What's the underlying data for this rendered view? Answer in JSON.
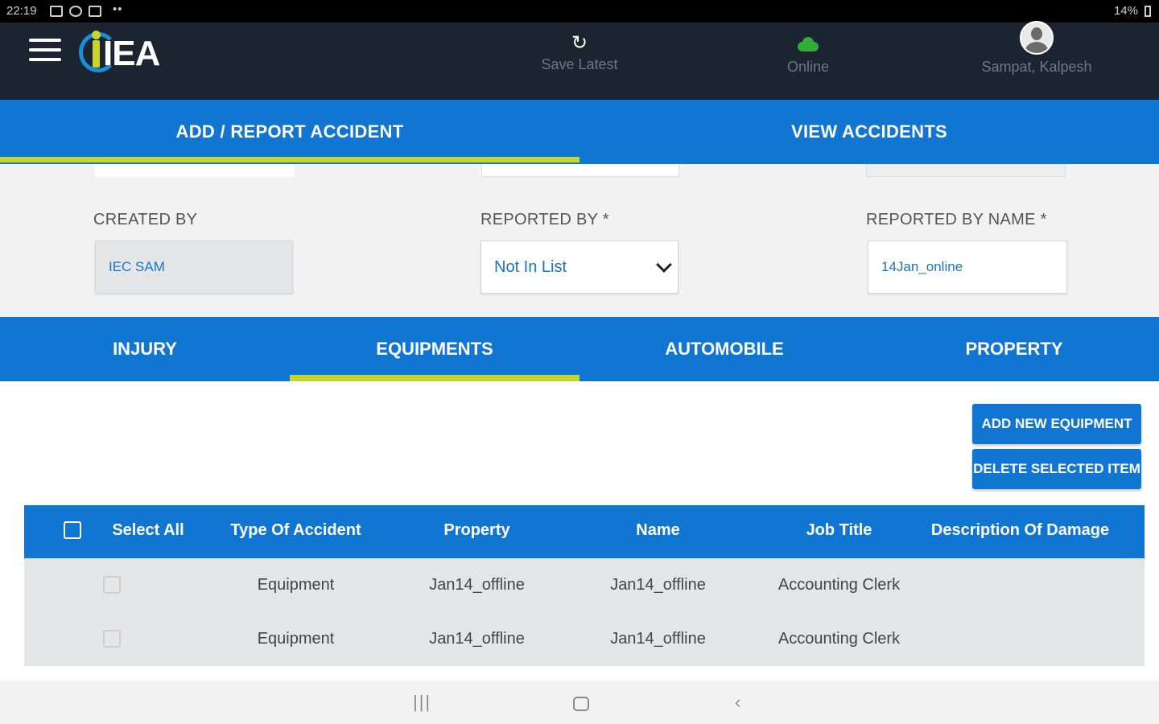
{
  "status_bar": {
    "time": "22:19",
    "dots": "••",
    "battery": "14%"
  },
  "header": {
    "logo_text": "IEA",
    "actions": [
      {
        "label": "Save Latest",
        "icon": "sync-icon"
      },
      {
        "label": "Online",
        "icon": "cloud-icon",
        "color": "#2fae3a"
      },
      {
        "label": "Sampat, Kalpesh",
        "icon": "avatar-icon"
      }
    ]
  },
  "top_tabs": [
    {
      "label": "ADD / REPORT ACCIDENT",
      "active": true
    },
    {
      "label": "VIEW ACCIDENTS",
      "active": false
    }
  ],
  "form": {
    "created_by": {
      "label": "CREATED BY",
      "value": "IEC SAM"
    },
    "reported_by": {
      "label": "REPORTED BY *",
      "value": "Not In List"
    },
    "reported_by_name": {
      "label": "REPORTED BY NAME *",
      "value": "14Jan_online"
    }
  },
  "sub_tabs": [
    {
      "label": "INJURY",
      "active": false
    },
    {
      "label": "EQUIPMENTS",
      "active": true
    },
    {
      "label": "AUTOMOBILE",
      "active": false
    },
    {
      "label": "PROPERTY",
      "active": false
    }
  ],
  "buttons": {
    "add_new": "ADD NEW EQUIPMENT",
    "delete_selected": "DELETE SELECTED ITEM"
  },
  "table": {
    "columns": [
      "Select All",
      "Type Of Accident",
      "Property",
      "Name",
      "Job Title",
      "Description Of Damage"
    ],
    "rows": [
      {
        "type": "Equipment",
        "property": "Jan14_offline",
        "name": "Jan14_offline",
        "job_title": "Accounting Clerk",
        "description": ""
      },
      {
        "type": "Equipment",
        "property": "Jan14_offline",
        "name": "Jan14_offline",
        "job_title": "Accounting Clerk",
        "description": ""
      }
    ]
  },
  "nav_bar": {
    "recent": "|||",
    "back": "‹"
  },
  "colors": {
    "primary": "#1176d1",
    "accent": "#c8d62b",
    "header_bg": "#1b2430"
  }
}
